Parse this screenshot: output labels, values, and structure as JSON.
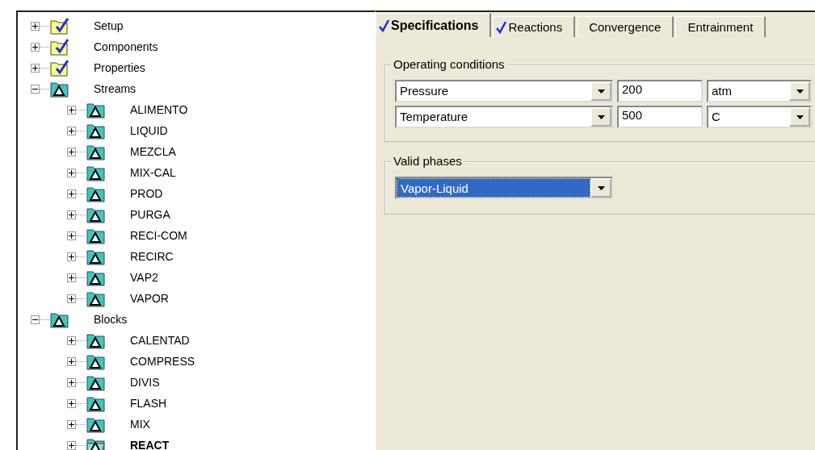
{
  "tree": [
    {
      "label": "Setup",
      "kind": "complete",
      "expanded": false,
      "selected": false
    },
    {
      "label": "Components",
      "kind": "complete",
      "expanded": false,
      "selected": false
    },
    {
      "label": "Properties",
      "kind": "complete",
      "expanded": false,
      "selected": false
    },
    {
      "label": "Streams",
      "kind": "input",
      "expanded": true,
      "selected": false,
      "children": [
        {
          "label": "ALIMENTO",
          "kind": "input",
          "expanded": false,
          "selected": false
        },
        {
          "label": "LIQUID",
          "kind": "input",
          "expanded": false,
          "selected": false
        },
        {
          "label": "MEZCLA",
          "kind": "input",
          "expanded": false,
          "selected": false
        },
        {
          "label": "MIX-CAL",
          "kind": "input",
          "expanded": false,
          "selected": false
        },
        {
          "label": "PROD",
          "kind": "input",
          "expanded": false,
          "selected": false
        },
        {
          "label": "PURGA",
          "kind": "input",
          "expanded": false,
          "selected": false
        },
        {
          "label": "RECI-COM",
          "kind": "input",
          "expanded": false,
          "selected": false
        },
        {
          "label": "RECIRC",
          "kind": "input",
          "expanded": false,
          "selected": false
        },
        {
          "label": "VAP2",
          "kind": "input",
          "expanded": false,
          "selected": false
        },
        {
          "label": "VAPOR",
          "kind": "input",
          "expanded": false,
          "selected": false
        }
      ]
    },
    {
      "label": "Blocks",
      "kind": "input",
      "expanded": true,
      "selected": false,
      "children": [
        {
          "label": "CALENTAD",
          "kind": "input",
          "expanded": false,
          "selected": false
        },
        {
          "label": "COMPRESS",
          "kind": "input",
          "expanded": false,
          "selected": false
        },
        {
          "label": "DIVIS",
          "kind": "input",
          "expanded": false,
          "selected": false
        },
        {
          "label": "FLASH",
          "kind": "input",
          "expanded": false,
          "selected": false
        },
        {
          "label": "MIX",
          "kind": "input",
          "expanded": false,
          "selected": false
        },
        {
          "label": "REACT",
          "kind": "input",
          "expanded": false,
          "selected": true
        }
      ]
    }
  ],
  "tabs": [
    {
      "label": "Specifications",
      "checked": true,
      "selected": true
    },
    {
      "label": "Reactions",
      "checked": true,
      "selected": false
    },
    {
      "label": "Convergence",
      "checked": false,
      "selected": false
    },
    {
      "label": "Entrainment",
      "checked": false,
      "selected": false
    }
  ],
  "operating_conditions": {
    "title": "Operating conditions",
    "rows": [
      {
        "variable": "Pressure",
        "value": "200",
        "unit": "atm"
      },
      {
        "variable": "Temperature",
        "value": "500",
        "unit": "C"
      }
    ]
  },
  "valid_phases": {
    "title": "Valid phases",
    "value": "Vapor-Liquid",
    "highlighted": true
  }
}
